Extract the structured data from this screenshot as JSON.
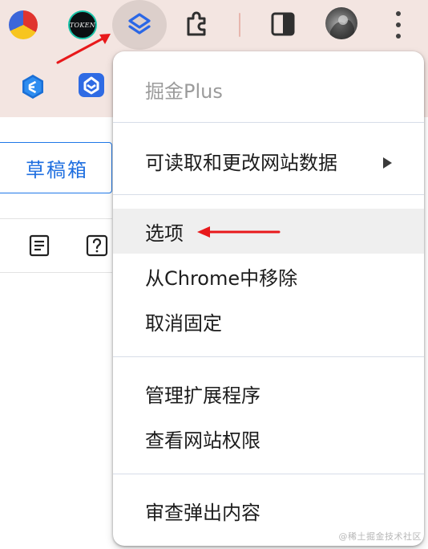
{
  "toolbar": {
    "token_badge": "TOKEN",
    "icons": [
      "pie-chart-extension-icon",
      "token-extension-icon",
      "juejin-plus-extension-icon",
      "extensions-puzzle-icon",
      "side-panel-icon",
      "profile-avatar",
      "more-options-icon"
    ]
  },
  "bookmarks": {
    "icons": [
      "blue-hexagon-icon",
      "blue-square-icon"
    ]
  },
  "page": {
    "drafts_button": "草稿箱"
  },
  "menu": {
    "title": "掘金Plus",
    "site_data": "可读取和更改网站数据",
    "options": "选项",
    "remove_from_chrome": "从Chrome中移除",
    "unpin": "取消固定",
    "manage_extensions": "管理扩展程序",
    "view_site_permissions": "查看网站权限",
    "inspect_popup": "审查弹出内容"
  },
  "colors": {
    "toolbar_bg": "#f3e5e1",
    "accent_blue": "#1f78e8",
    "annotation_red": "#e8191b",
    "highlight_bg": "#efefef"
  },
  "watermark": "@稀土掘金技术社区"
}
